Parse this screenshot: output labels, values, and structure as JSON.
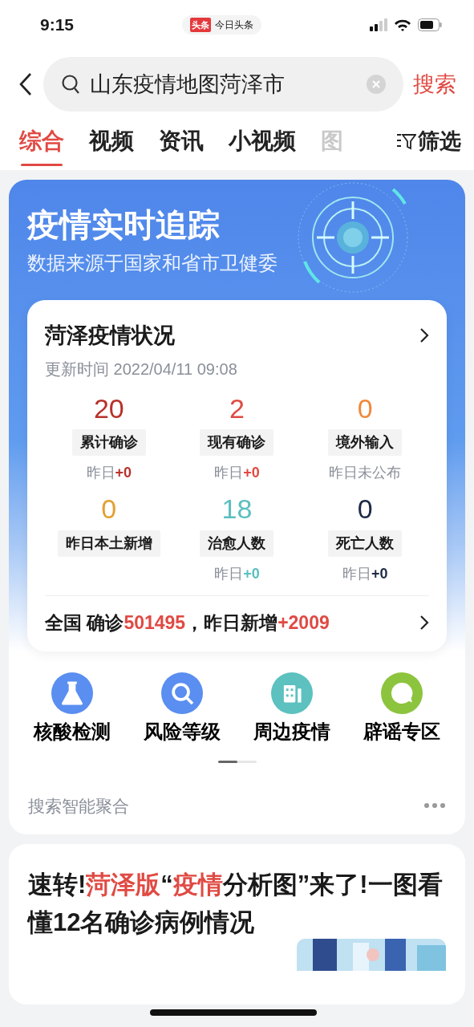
{
  "status_bar": {
    "time": "9:15",
    "app_badge": "头条",
    "app_name": "今日头条"
  },
  "search": {
    "value": "山东疫情地图菏泽市",
    "button": "搜索"
  },
  "tabs": [
    {
      "label": "综合",
      "selected": true
    },
    {
      "label": "视频",
      "selected": false
    },
    {
      "label": "资讯",
      "selected": false
    },
    {
      "label": "小视频",
      "selected": false
    },
    {
      "label": "图",
      "selected": false
    }
  ],
  "filter": {
    "label": "筛选"
  },
  "banner": {
    "title": "疫情实时追踪",
    "subtitle": "数据来源于国家和省市卫健委"
  },
  "status_card": {
    "title": "菏泽疫情状况",
    "updated": "更新时间 2022/04/11 09:08",
    "stats": [
      {
        "value": "20",
        "label": "累计确诊",
        "color": "#b8312b",
        "yesterday": "昨日",
        "delta": "+0"
      },
      {
        "value": "2",
        "label": "现有确诊",
        "color": "#e04a43",
        "yesterday": "昨日",
        "delta": "+0"
      },
      {
        "value": "0",
        "label": "境外输入",
        "color": "#ef8a3c",
        "yesterday": "昨日未公布"
      },
      {
        "value": "0",
        "label": "昨日本土新增",
        "color": "#e3a032"
      },
      {
        "value": "18",
        "label": "治愈人数",
        "color": "#5bbfc0",
        "yesterday": "昨日",
        "delta": "+0"
      },
      {
        "value": "0",
        "label": "死亡人数",
        "color": "#1d2b45",
        "yesterday": "昨日",
        "delta": "+0"
      }
    ],
    "national": [
      {
        "text": "全国 确诊",
        "highlight": false
      },
      {
        "text": "501495",
        "highlight": true
      },
      {
        "text": "，昨日新增",
        "highlight": false
      },
      {
        "text": "+2009",
        "highlight": true
      }
    ]
  },
  "shortcuts": [
    {
      "kind": "flask",
      "label": "核酸检测",
      "color": "#5a8ef0"
    },
    {
      "kind": "search",
      "label": "风险等级",
      "color": "#5a8ef0"
    },
    {
      "kind": "building",
      "label": "周边疫情",
      "color": "#5cc1bf"
    },
    {
      "kind": "question",
      "label": "辟谣专区",
      "color": "#8cc43e"
    }
  ],
  "aggregate": {
    "label": "搜索智能聚合"
  },
  "article": {
    "headline": [
      {
        "text": "速转!",
        "highlight": false
      },
      {
        "text": "菏泽版",
        "highlight": true
      },
      {
        "text": "“",
        "highlight": false
      },
      {
        "text": "疫情",
        "highlight": true
      },
      {
        "text": "分析图”来了!一图看懂12名确诊病例情况",
        "highlight": false
      }
    ],
    "kind": "picture"
  }
}
